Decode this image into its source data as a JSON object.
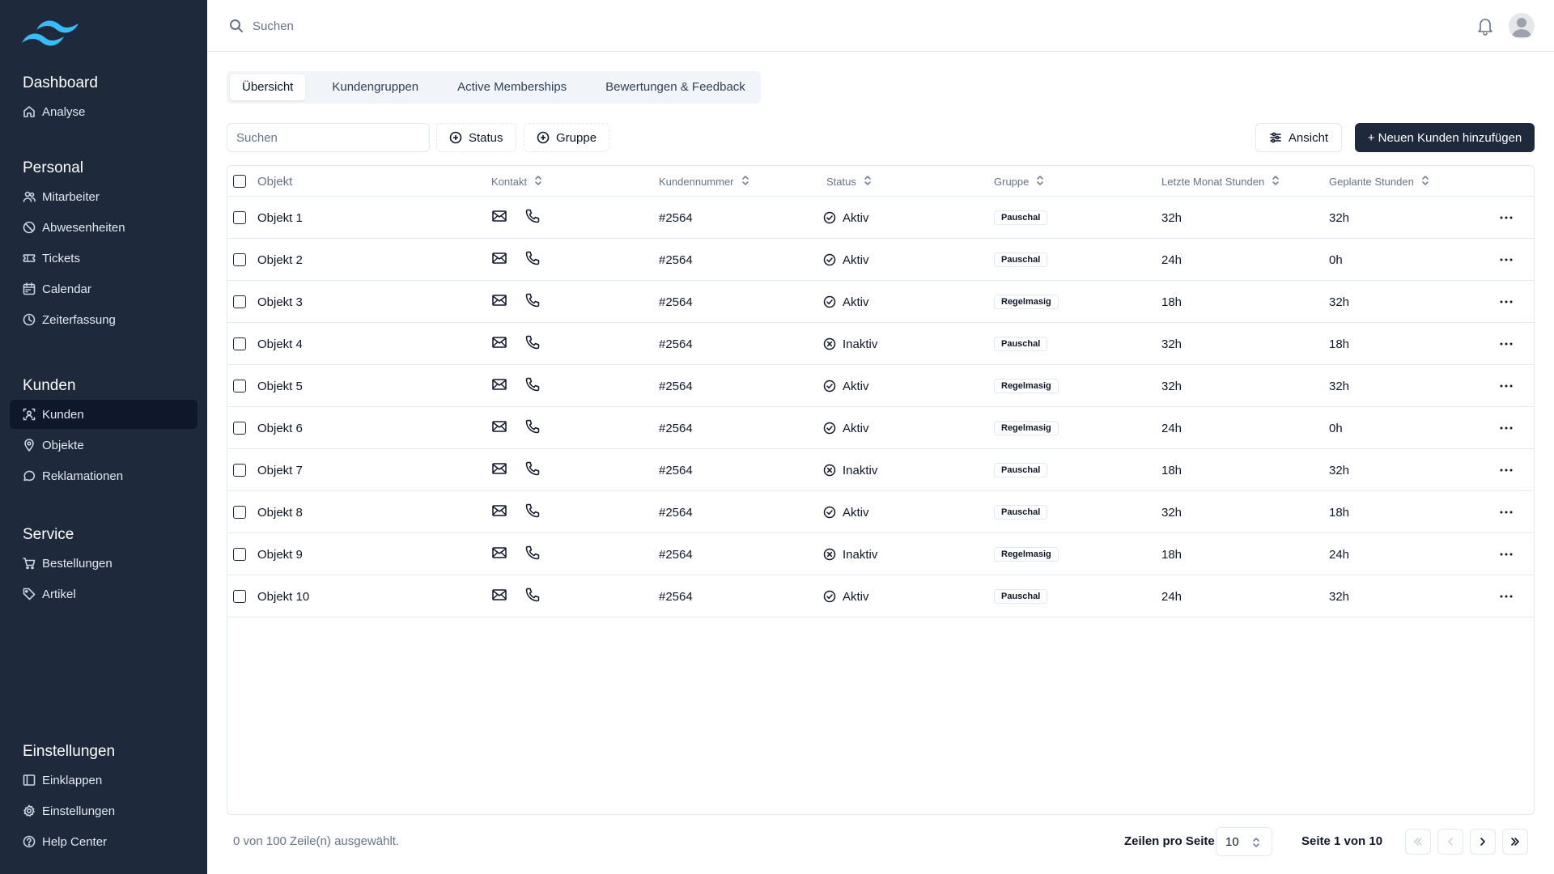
{
  "topbar": {
    "search_placeholder": "Suchen"
  },
  "sidebar": {
    "groups": [
      {
        "title": "Dashboard",
        "items": [
          {
            "label": "Analyse",
            "icon": "home-icon"
          }
        ]
      },
      {
        "title": "Personal",
        "items": [
          {
            "label": "Mitarbeiter",
            "icon": "users-icon"
          },
          {
            "label": "Abwesenheiten",
            "icon": "ban-icon"
          },
          {
            "label": "Tickets",
            "icon": "ticket-icon"
          },
          {
            "label": "Calendar",
            "icon": "calendar-icon"
          },
          {
            "label": "Zeiterfassung",
            "icon": "clock-icon"
          }
        ]
      },
      {
        "title": "Kunden",
        "items": [
          {
            "label": "Kunden",
            "icon": "contact-icon",
            "active": true
          },
          {
            "label": "Objekte",
            "icon": "map-pin-icon"
          },
          {
            "label": "Reklamationen",
            "icon": "message-icon"
          }
        ]
      },
      {
        "title": "Service",
        "items": [
          {
            "label": "Bestellungen",
            "icon": "cart-icon"
          },
          {
            "label": "Artikel",
            "icon": "tag-icon"
          }
        ]
      },
      {
        "title": "Einstellungen",
        "items": [
          {
            "label": "Einklappen",
            "icon": "panel-icon"
          },
          {
            "label": "Einstellungen",
            "icon": "settings-icon"
          },
          {
            "label": "Help Center",
            "icon": "help-icon"
          }
        ]
      }
    ]
  },
  "tabs": [
    "Übersicht",
    "Kundengruppen",
    "Active Memberships",
    "Bewertungen & Feedback"
  ],
  "toolbar": {
    "filter_placeholder": "Suchen",
    "status_label": "Status",
    "group_label": "Gruppe",
    "view_label": "Ansicht",
    "add_label": "+ Neuen Kunden hinzufügen"
  },
  "table": {
    "headers": {
      "object": "Objekt",
      "contact": "Kontakt",
      "number": "Kundennummer",
      "status": "Status",
      "group": "Gruppe",
      "last_month": "Letzte Monat Stunden",
      "planned": "Geplante Stunden"
    },
    "rows": [
      {
        "name": "Objekt 1",
        "number": "#2564",
        "status": "Aktiv",
        "group": "Pauschal",
        "last": "32h",
        "planned": "32h"
      },
      {
        "name": "Objekt 2",
        "number": "#2564",
        "status": "Aktiv",
        "group": "Pauschal",
        "last": "24h",
        "planned": "0h"
      },
      {
        "name": "Objekt 3",
        "number": "#2564",
        "status": "Aktiv",
        "group": "Regelmasig",
        "last": "18h",
        "planned": "32h"
      },
      {
        "name": "Objekt 4",
        "number": "#2564",
        "status": "Inaktiv",
        "group": "Pauschal",
        "last": "32h",
        "planned": "18h"
      },
      {
        "name": "Objekt 5",
        "number": "#2564",
        "status": "Aktiv",
        "group": "Regelmasig",
        "last": "32h",
        "planned": "32h"
      },
      {
        "name": "Objekt 6",
        "number": "#2564",
        "status": "Aktiv",
        "group": "Regelmasig",
        "last": "24h",
        "planned": "0h"
      },
      {
        "name": "Objekt 7",
        "number": "#2564",
        "status": "Inaktiv",
        "group": "Pauschal",
        "last": "18h",
        "planned": "32h"
      },
      {
        "name": "Objekt 8",
        "number": "#2564",
        "status": "Aktiv",
        "group": "Pauschal",
        "last": "32h",
        "planned": "18h"
      },
      {
        "name": "Objekt 9",
        "number": "#2564",
        "status": "Inaktiv",
        "group": "Regelmasig",
        "last": "18h",
        "planned": "24h"
      },
      {
        "name": "Objekt 10",
        "number": "#2564",
        "status": "Aktiv",
        "group": "Pauschal",
        "last": "24h",
        "planned": "32h"
      }
    ]
  },
  "footer": {
    "selection": "0 von 100 Zeile(n) ausgewählt.",
    "rows_per_page_label": "Zeilen pro Seite",
    "rows_per_page_value": "10",
    "page_info": "Seite 1 von 10"
  },
  "colors": {
    "sidebar_bg": "#1e293b",
    "primary_button": "#1e293b",
    "border": "#e2e8f0",
    "muted_text": "#64748b"
  }
}
